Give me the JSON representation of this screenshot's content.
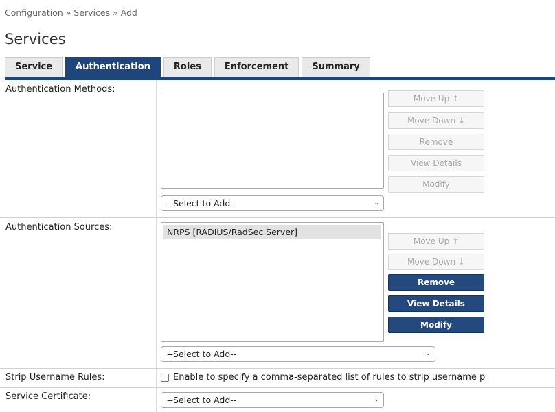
{
  "breadcrumb": "Configuration » Services » Add",
  "page_title": "Services",
  "tabs": [
    {
      "label": "Service",
      "active": false
    },
    {
      "label": "Authentication",
      "active": true
    },
    {
      "label": "Roles",
      "active": false
    },
    {
      "label": "Enforcement",
      "active": false
    },
    {
      "label": "Summary",
      "active": false
    }
  ],
  "auth_methods": {
    "label": "Authentication Methods:",
    "items": [],
    "buttons": {
      "move_up": "Move Up ↑",
      "move_down": "Move Down ↓",
      "remove": "Remove",
      "view_details": "View Details",
      "modify": "Modify"
    },
    "select_value": "--Select to Add--"
  },
  "auth_sources": {
    "label": "Authentication Sources:",
    "items": [
      "NRPS [RADIUS/RadSec Server]"
    ],
    "buttons": {
      "move_up": "Move Up ↑",
      "move_down": "Move Down ↓",
      "remove": "Remove",
      "view_details": "View Details",
      "modify": "Modify"
    },
    "select_value": "--Select to Add--"
  },
  "strip_username": {
    "label": "Strip Username Rules:",
    "checkbox_text": "Enable to specify a comma-separated list of rules to strip username p",
    "checked": false
  },
  "service_certificate": {
    "label": "Service Certificate:",
    "select_value": "--Select to Add--"
  },
  "colors": {
    "accent": "#1e457c",
    "button_enabled": "#24497e"
  }
}
